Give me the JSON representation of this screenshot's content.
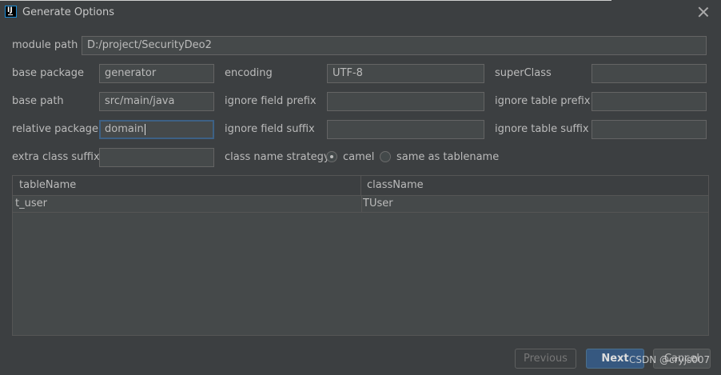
{
  "window": {
    "title": "Generate Options"
  },
  "form": {
    "module_path_label": "module path",
    "module_path_value": "D:/project/SecurityDeo2",
    "base_package_label": "base package",
    "base_package_value": "generator",
    "base_path_label": "base path",
    "base_path_value": "src/main/java",
    "relative_package_label": "relative package",
    "relative_package_value": "domain",
    "extra_class_suffix_label": "extra class suffix",
    "extra_class_suffix_value": "",
    "encoding_label": "encoding",
    "encoding_value": "UTF-8",
    "ignore_field_prefix_label": "ignore field prefix",
    "ignore_field_prefix_value": "",
    "ignore_field_suffix_label": "ignore field suffix",
    "ignore_field_suffix_value": "",
    "class_name_strategy_label": "class name strategy",
    "strategy_options": [
      "camel",
      "same as tablename"
    ],
    "strategy_selected": "camel",
    "superclass_label": "superClass",
    "superclass_value": "",
    "ignore_table_prefix_label": "ignore table prefix",
    "ignore_table_prefix_value": "",
    "ignore_table_suffix_label": "ignore table suffix",
    "ignore_table_suffix_value": ""
  },
  "table": {
    "columns": [
      "tableName",
      "className"
    ],
    "rows": [
      [
        "t_user",
        "TUser"
      ]
    ]
  },
  "buttons": {
    "previous": "Previous",
    "next": "Next",
    "cancel": "Cancel"
  },
  "watermark": "CSDN @cryjs007",
  "icons": {
    "app": "intellij-app-icon",
    "close": "close-icon"
  },
  "colors": {
    "background": "#3c3f41",
    "field": "#45494a",
    "focus_border": "#3d6185",
    "primary_button": "#365880"
  }
}
